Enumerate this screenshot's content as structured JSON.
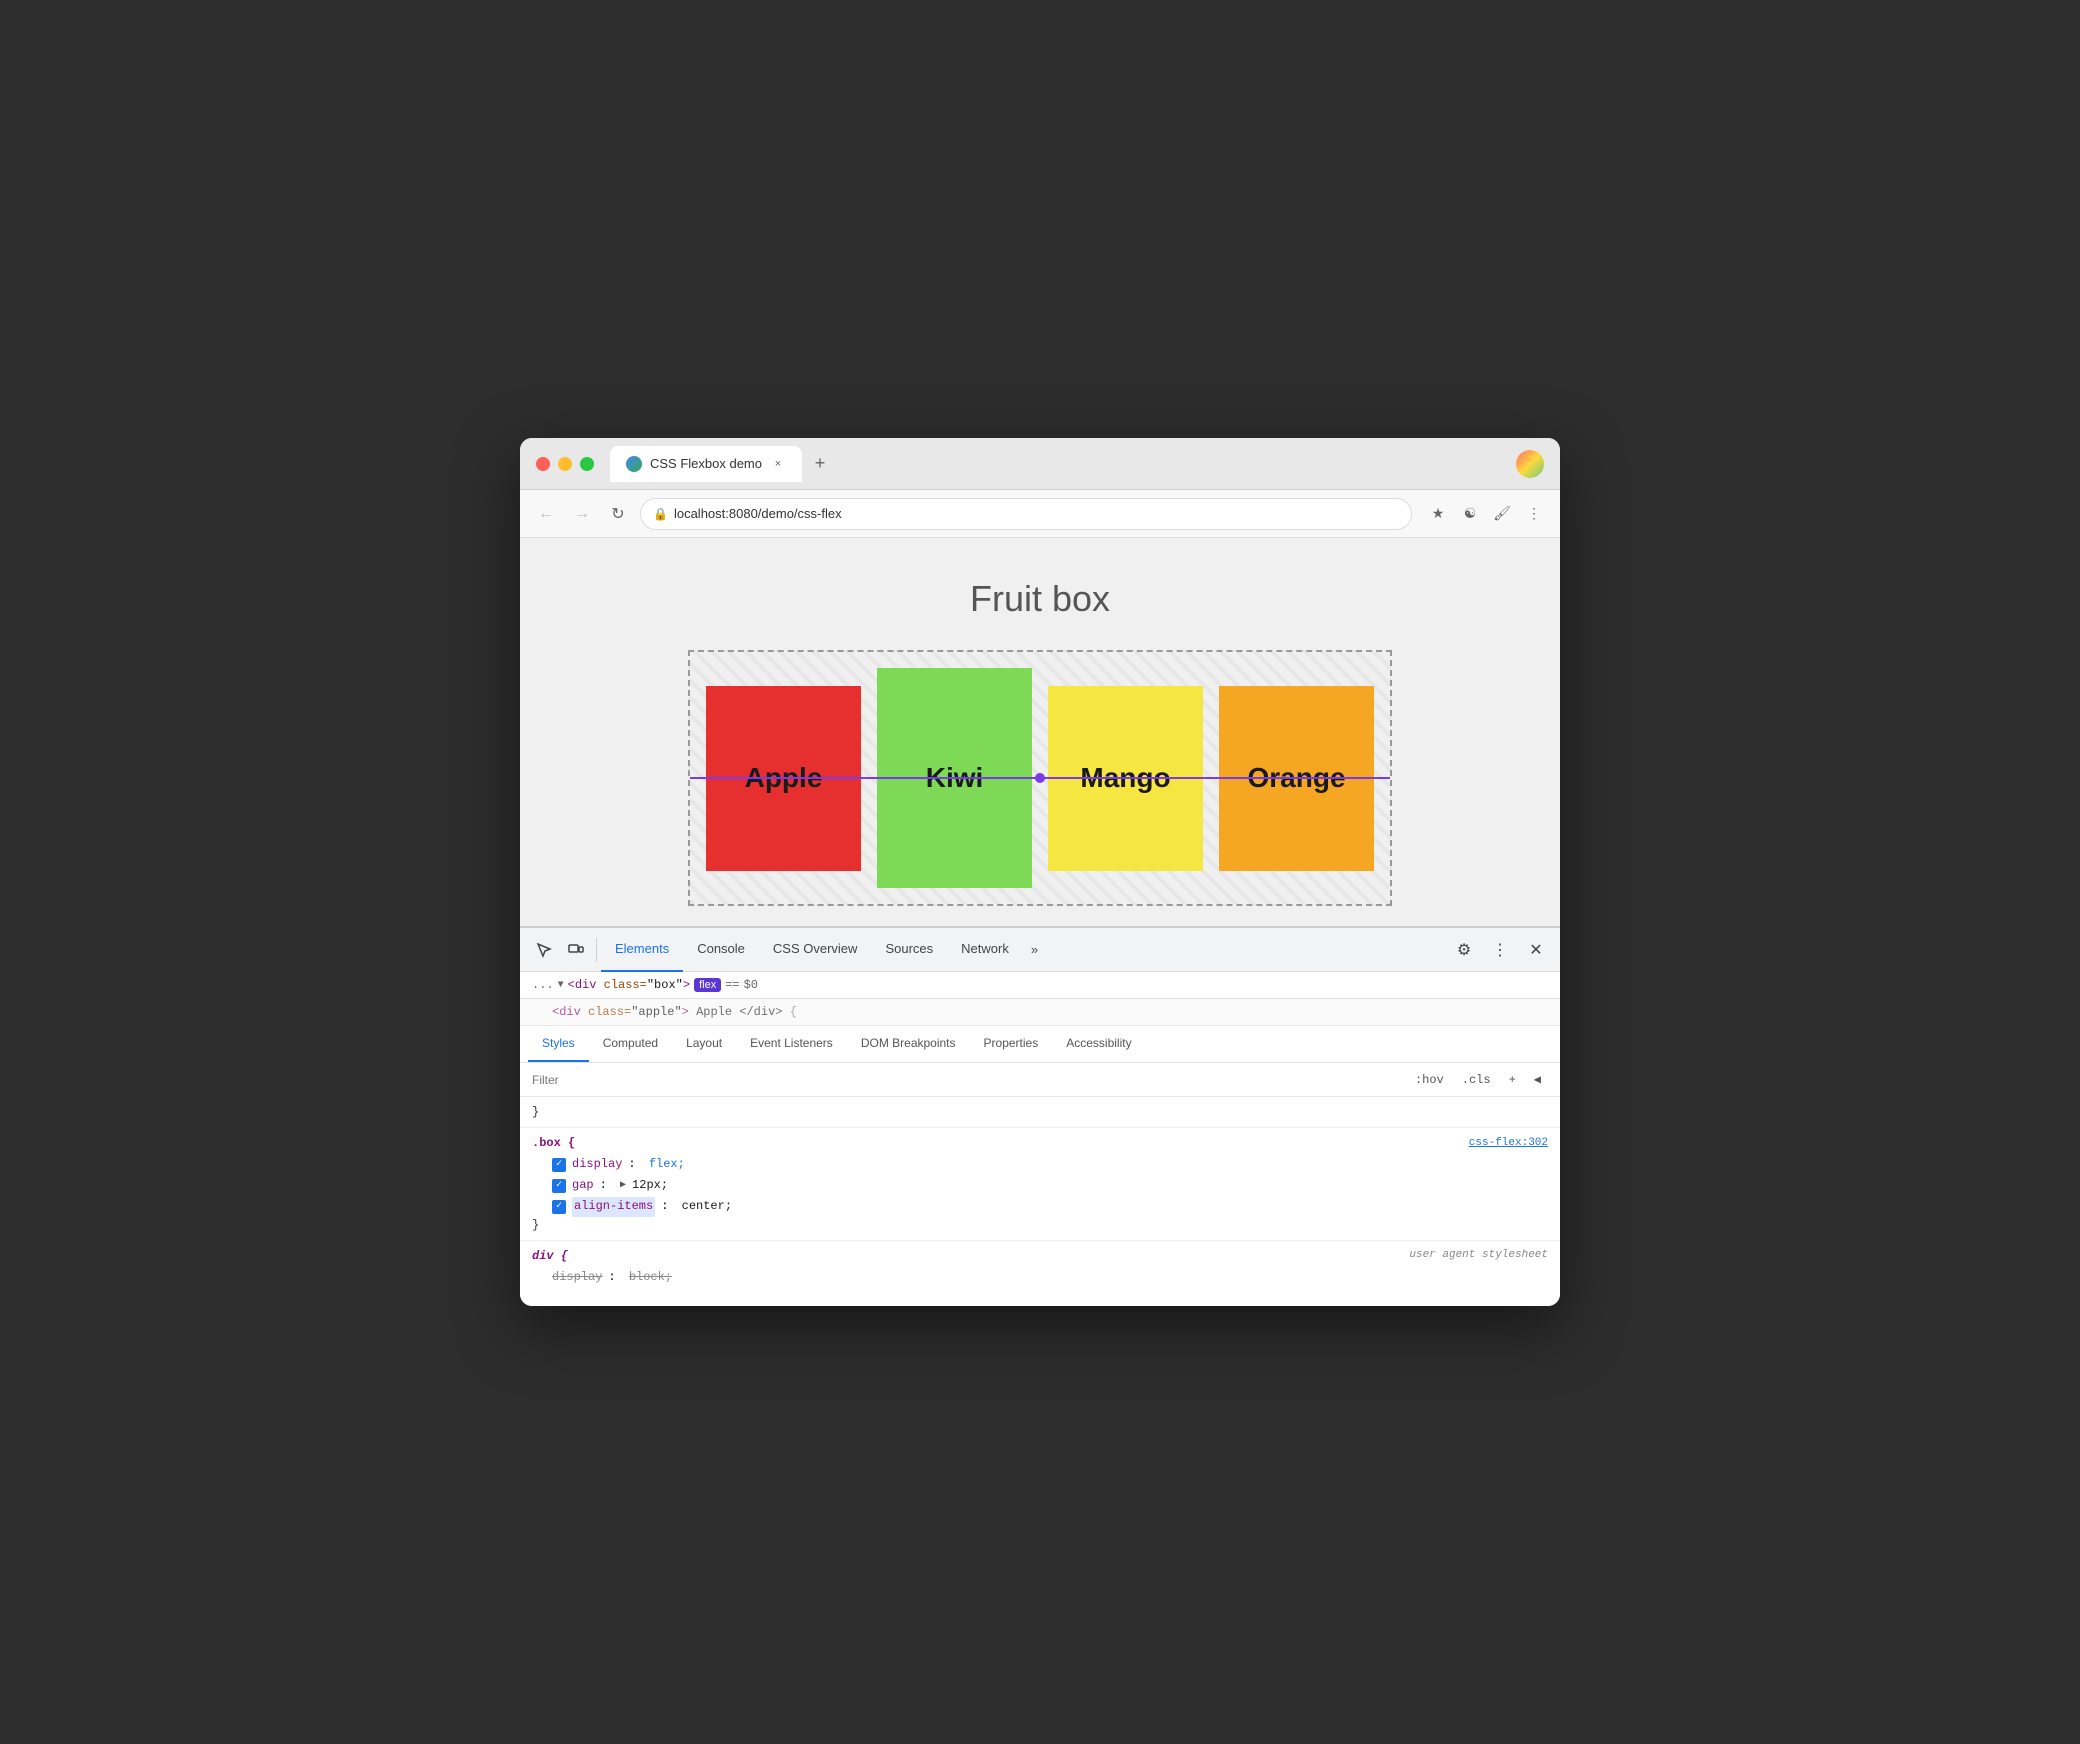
{
  "browser": {
    "tab_title": "CSS Flexbox demo",
    "url": "localhost:8080/demo/css-flex",
    "close_label": "×",
    "new_tab_label": "+"
  },
  "page": {
    "title": "Fruit box",
    "fruits": [
      {
        "name": "Apple",
        "color": "#e63030"
      },
      {
        "name": "Kiwi",
        "color": "#7ed957"
      },
      {
        "name": "Mango",
        "color": "#f5e642"
      },
      {
        "name": "Orange",
        "color": "#f5a623"
      }
    ]
  },
  "devtools": {
    "tabs": [
      "Elements",
      "Console",
      "CSS Overview",
      "Sources",
      "Network"
    ],
    "active_tab": "Elements",
    "more_label": "»",
    "dom_breadcrumb": {
      "ellipsis": "...",
      "tag": "div",
      "class_attr": "class",
      "class_value": "\"box\"",
      "badge": "flex",
      "equals": "==",
      "dollar": "$0"
    },
    "inner_tabs": [
      "Styles",
      "Computed",
      "Layout",
      "Event Listeners",
      "DOM Breakpoints",
      "Properties",
      "Accessibility"
    ],
    "active_inner_tab": "Styles",
    "filter_placeholder": "Filter",
    "filter_buttons": [
      ":hov",
      ".cls",
      "+",
      "◀"
    ],
    "styles": {
      "empty_brace_close": "}",
      "rule1": {
        "selector": ".box {",
        "source": "css-flex:302",
        "properties": [
          {
            "checked": true,
            "name": "display",
            "value": "flex;"
          },
          {
            "checked": true,
            "name": "gap",
            "prefix": "▶ ",
            "value": "12px;"
          },
          {
            "checked": true,
            "name": "align-items",
            "value": "center;",
            "highlighted": true
          }
        ],
        "close": "}"
      },
      "rule2": {
        "selector": "div {",
        "source": "user agent stylesheet",
        "properties": [
          {
            "checked": false,
            "name": "display",
            "value": "block;",
            "strikethrough": true
          }
        ]
      }
    }
  }
}
